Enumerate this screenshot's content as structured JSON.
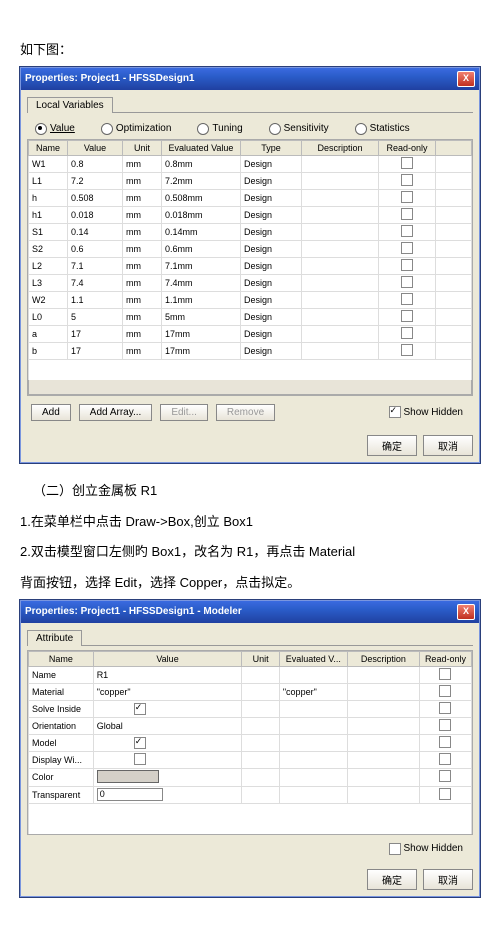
{
  "text": {
    "intro": "如下图：",
    "section_head": "（二）创立金属板 R1",
    "step1": "1.在菜单栏中点击 Draw->Box,创立 Box1",
    "step2a": "2.双击模型窗口左侧旳 Box1，改名为 R1，再点击 Material",
    "step2b": "背面按钮，选择 Edit，选择 Copper，点击拟定。"
  },
  "win1": {
    "title": "Properties: Project1 - HFSSDesign1",
    "tab": "Local Variables",
    "radios": [
      "Value",
      "Optimization",
      "Tuning",
      "Sensitivity",
      "Statistics"
    ],
    "selected_radio": 0,
    "cols": [
      "Name",
      "Value",
      "Unit",
      "Evaluated Value",
      "Type",
      "Description",
      "Read-only"
    ],
    "rows": [
      {
        "n": "W1",
        "v": "0.8",
        "u": "mm",
        "e": "0.8mm",
        "t": "Design"
      },
      {
        "n": "L1",
        "v": "7.2",
        "u": "mm",
        "e": "7.2mm",
        "t": "Design"
      },
      {
        "n": "h",
        "v": "0.508",
        "u": "mm",
        "e": "0.508mm",
        "t": "Design"
      },
      {
        "n": "h1",
        "v": "0.018",
        "u": "mm",
        "e": "0.018mm",
        "t": "Design"
      },
      {
        "n": "S1",
        "v": "0.14",
        "u": "mm",
        "e": "0.14mm",
        "t": "Design"
      },
      {
        "n": "S2",
        "v": "0.6",
        "u": "mm",
        "e": "0.6mm",
        "t": "Design"
      },
      {
        "n": "L2",
        "v": "7.1",
        "u": "mm",
        "e": "7.1mm",
        "t": "Design"
      },
      {
        "n": "L3",
        "v": "7.4",
        "u": "mm",
        "e": "7.4mm",
        "t": "Design"
      },
      {
        "n": "W2",
        "v": "1.1",
        "u": "mm",
        "e": "1.1mm",
        "t": "Design"
      },
      {
        "n": "L0",
        "v": "5",
        "u": "mm",
        "e": "5mm",
        "t": "Design"
      },
      {
        "n": "a",
        "v": "17",
        "u": "mm",
        "e": "17mm",
        "t": "Design"
      },
      {
        "n": "b",
        "v": "17",
        "u": "mm",
        "e": "17mm",
        "t": "Design"
      }
    ],
    "buttons": {
      "add": "Add",
      "addarray": "Add Array...",
      "edit": "Edit...",
      "remove": "Remove"
    },
    "show_hidden": "Show Hidden",
    "ok": "确定",
    "cancel": "取消"
  },
  "win2": {
    "title": "Properties: Project1 - HFSSDesign1 - Modeler",
    "tab": "Attribute",
    "cols": [
      "Name",
      "Value",
      "Unit",
      "Evaluated V...",
      "Description",
      "Read-only"
    ],
    "rows": [
      {
        "n": "Name",
        "v": "R1",
        "kind": "text"
      },
      {
        "n": "Material",
        "v": "\"copper\"",
        "ev": "\"copper\"",
        "kind": "text"
      },
      {
        "n": "Solve Inside",
        "kind": "check",
        "checked": true
      },
      {
        "n": "Orientation",
        "v": "Global",
        "kind": "text"
      },
      {
        "n": "Model",
        "kind": "check",
        "checked": true
      },
      {
        "n": "Display Wi...",
        "kind": "check",
        "checked": false
      },
      {
        "n": "Color",
        "kind": "swatch"
      },
      {
        "n": "Transparent",
        "v": "0",
        "kind": "box"
      }
    ],
    "show_hidden": "Show Hidden",
    "ok": "确定",
    "cancel": "取消"
  }
}
